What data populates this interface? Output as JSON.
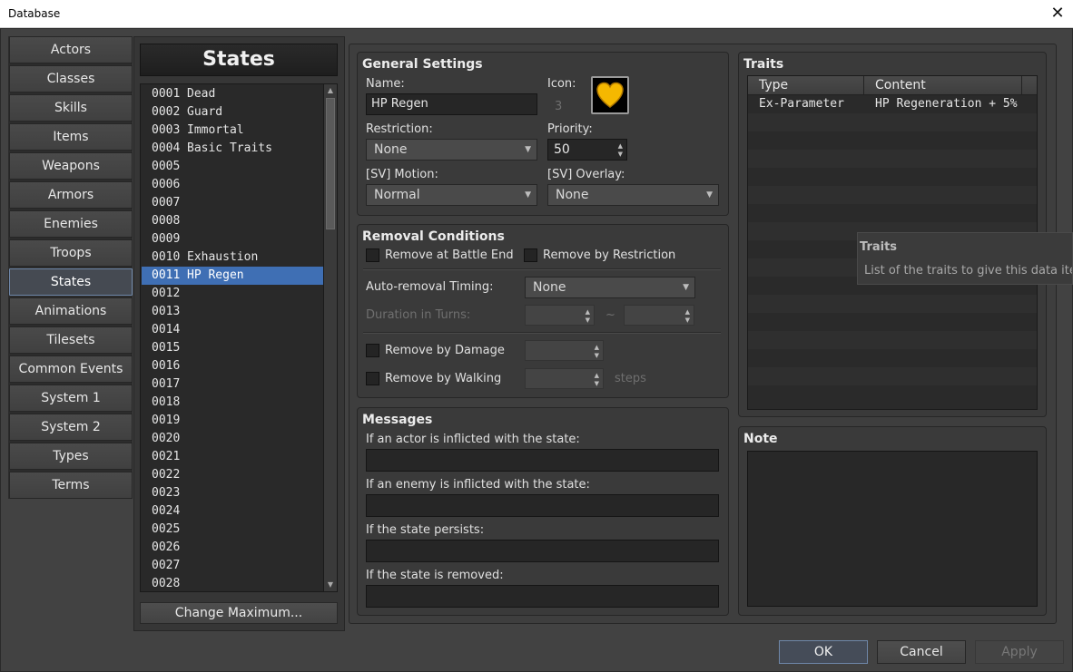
{
  "window": {
    "title": "Database",
    "close_glyph": "✕"
  },
  "categories": [
    "Actors",
    "Classes",
    "Skills",
    "Items",
    "Weapons",
    "Armors",
    "Enemies",
    "Troops",
    "States",
    "Animations",
    "Tilesets",
    "Common Events",
    "System 1",
    "System 2",
    "Types",
    "Terms"
  ],
  "active_category": "States",
  "list": {
    "title": "States",
    "selected_id": "0011",
    "items": [
      {
        "id": "0001",
        "name": "Dead"
      },
      {
        "id": "0002",
        "name": "Guard"
      },
      {
        "id": "0003",
        "name": "Immortal"
      },
      {
        "id": "0004",
        "name": "Basic Traits"
      },
      {
        "id": "0005",
        "name": ""
      },
      {
        "id": "0006",
        "name": ""
      },
      {
        "id": "0007",
        "name": ""
      },
      {
        "id": "0008",
        "name": ""
      },
      {
        "id": "0009",
        "name": ""
      },
      {
        "id": "0010",
        "name": "Exhaustion"
      },
      {
        "id": "0011",
        "name": "HP Regen"
      },
      {
        "id": "0012",
        "name": ""
      },
      {
        "id": "0013",
        "name": ""
      },
      {
        "id": "0014",
        "name": ""
      },
      {
        "id": "0015",
        "name": ""
      },
      {
        "id": "0016",
        "name": ""
      },
      {
        "id": "0017",
        "name": ""
      },
      {
        "id": "0018",
        "name": ""
      },
      {
        "id": "0019",
        "name": ""
      },
      {
        "id": "0020",
        "name": ""
      },
      {
        "id": "0021",
        "name": ""
      },
      {
        "id": "0022",
        "name": ""
      },
      {
        "id": "0023",
        "name": ""
      },
      {
        "id": "0024",
        "name": ""
      },
      {
        "id": "0025",
        "name": ""
      },
      {
        "id": "0026",
        "name": ""
      },
      {
        "id": "0027",
        "name": ""
      },
      {
        "id": "0028",
        "name": ""
      }
    ],
    "change_max_label": "Change Maximum..."
  },
  "general": {
    "title": "General Settings",
    "name_label": "Name:",
    "name_value": "HP Regen",
    "icon_label": "Icon:",
    "icon_index": "3",
    "icon_name": "heart-icon",
    "icon_color": "#f5b800",
    "restriction_label": "Restriction:",
    "restriction_value": "None",
    "priority_label": "Priority:",
    "priority_value": "50",
    "motion_label": "[SV] Motion:",
    "motion_value": "Normal",
    "overlay_label": "[SV] Overlay:",
    "overlay_value": "None"
  },
  "removal": {
    "title": "Removal Conditions",
    "battle_end_label": "Remove at Battle End",
    "restriction_label": "Remove by Restriction",
    "timing_label": "Auto-removal Timing:",
    "timing_value": "None",
    "duration_label": "Duration in Turns:",
    "duration_sep": "~",
    "damage_label": "Remove by Damage",
    "walking_label": "Remove by Walking",
    "steps_label": "steps"
  },
  "messages": {
    "title": "Messages",
    "actor_label": "If an actor is inflicted with the state:",
    "enemy_label": "If an enemy is inflicted with the state:",
    "persist_label": "If the state persists:",
    "removed_label": "If the state is removed:",
    "actor_value": "",
    "enemy_value": "",
    "persist_value": "",
    "removed_value": ""
  },
  "traits": {
    "title": "Traits",
    "columns": [
      "Type",
      "Content"
    ],
    "rows": [
      {
        "type": "Ex-Parameter",
        "content": "HP Regeneration + 5%"
      }
    ]
  },
  "tooltip": {
    "title": "Traits",
    "text": "List of the traits to give this data ite"
  },
  "note": {
    "title": "Note",
    "value": ""
  },
  "buttons": {
    "ok": "OK",
    "cancel": "Cancel",
    "apply": "Apply"
  }
}
